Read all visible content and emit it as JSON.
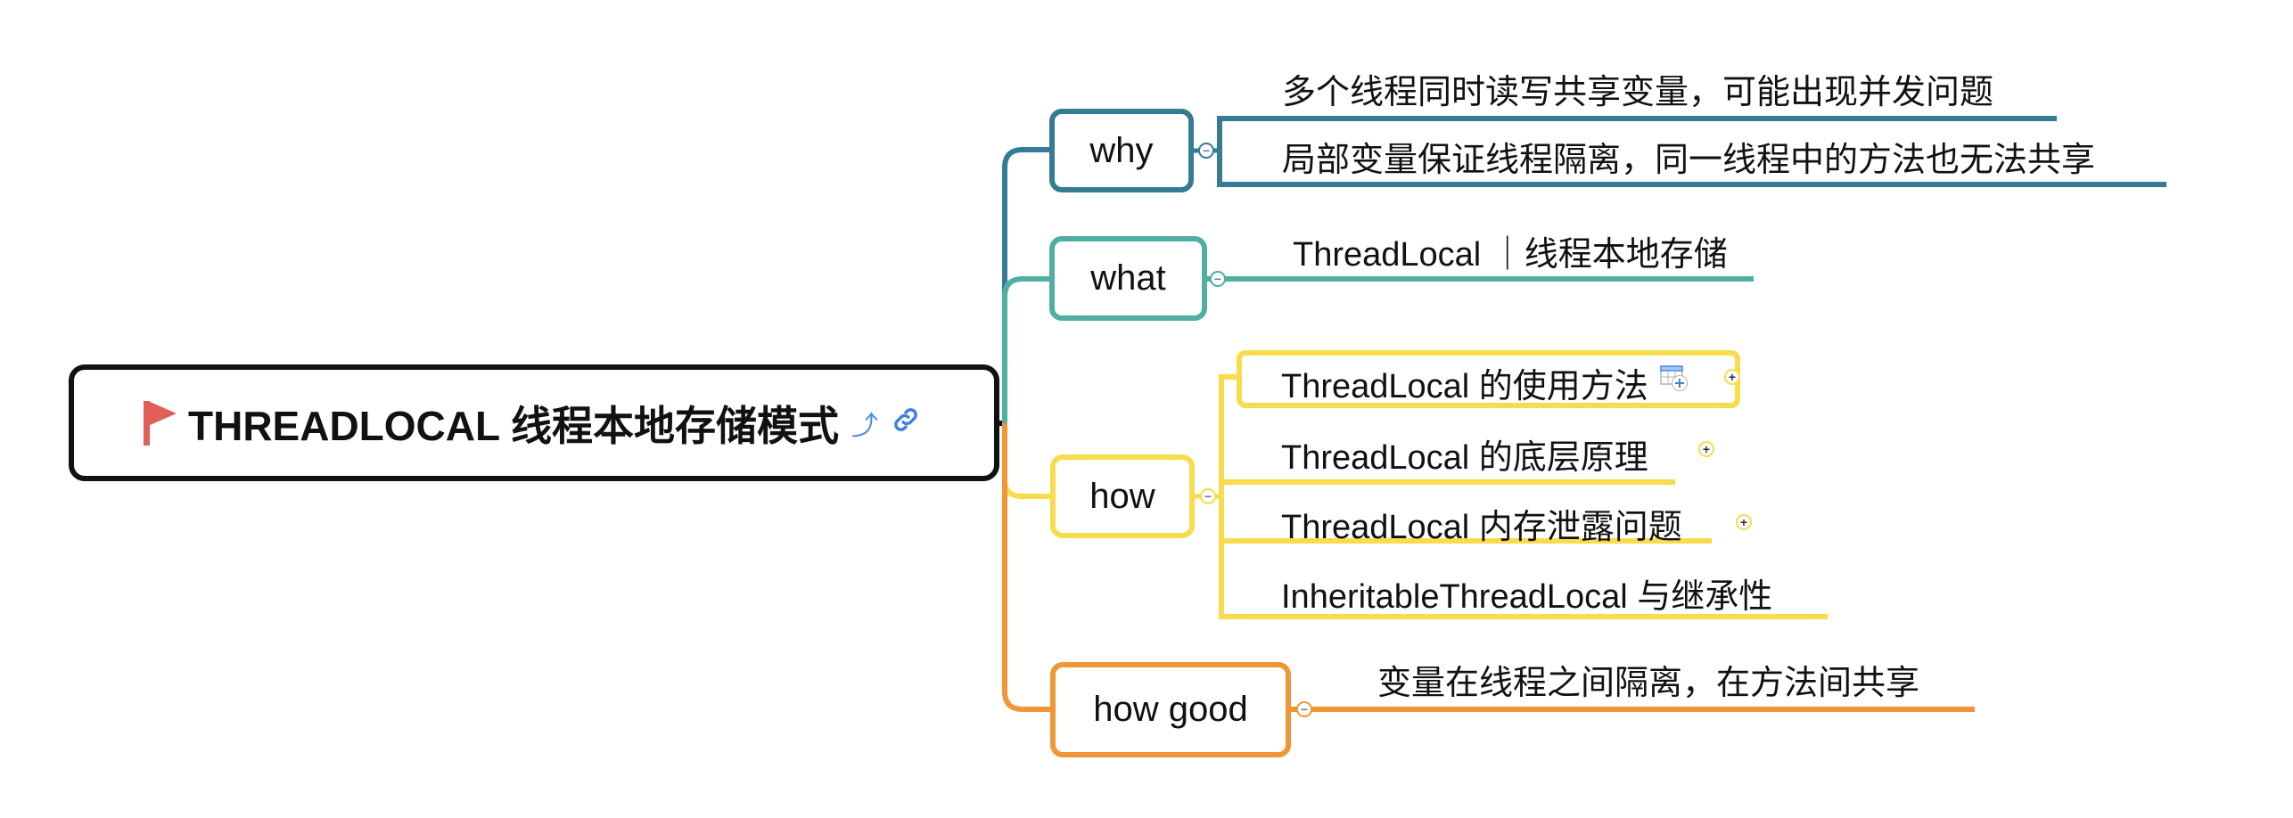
{
  "root": {
    "title": "THREADLOCAL 线程本地存储模式",
    "flag_icon": "red-flag-icon",
    "icons": [
      "back-arrow-icon",
      "link-icon"
    ]
  },
  "branches": [
    {
      "label": "why",
      "color": "#357b95",
      "children": [
        "多个线程同时读写共享变量，可能出现并发问题",
        "局部变量保证线程隔离，同一线程中的方法也无法共享"
      ]
    },
    {
      "label": "what",
      "color": "#50afa2",
      "children": [
        "ThreadLocal ｜线程本地存储"
      ]
    },
    {
      "label": "how",
      "color": "#f8dc4b",
      "children": [
        "ThreadLocal 的使用方法",
        "ThreadLocal 的底层原理",
        "ThreadLocal 内存泄露问题",
        "InheritableThreadLocal 与继承性"
      ]
    },
    {
      "label": "how good",
      "color": "#ef9636",
      "children": [
        "变量在线程之间隔离，在方法间共享"
      ]
    }
  ],
  "glyphs": {
    "collapse": "−",
    "expand": "+",
    "back": "⤴",
    "link": "🔗"
  }
}
